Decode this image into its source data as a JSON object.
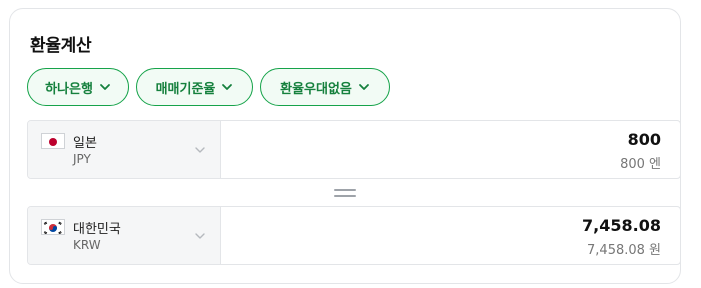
{
  "title": "환율계산",
  "chips": [
    {
      "label": "하나은행"
    },
    {
      "label": "매매기준율"
    },
    {
      "label": "환율우대없음"
    }
  ],
  "from": {
    "country": "일본",
    "code": "JPY",
    "flag_icon": "japan-flag-icon",
    "amount": "800",
    "amount_text": "800 엔"
  },
  "to": {
    "country": "대한민국",
    "code": "KRW",
    "flag_icon": "korea-flag-icon",
    "amount": "7,458.08",
    "amount_text": "7,458.08 원"
  },
  "colors": {
    "accent": "#16a34a",
    "chip_bg": "#f2fbf5",
    "selector_bg": "#f5f6f7"
  }
}
